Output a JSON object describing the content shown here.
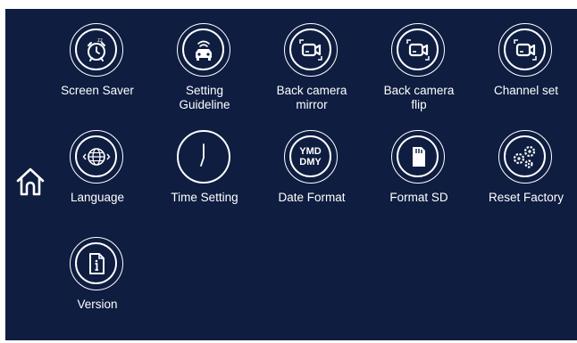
{
  "colors": {
    "background": "#0e1d40",
    "foreground": "#ffffff"
  },
  "home": {
    "icon": "home-icon"
  },
  "menu": [
    {
      "label": "Screen Saver",
      "icon": "alarm-clock-icon"
    },
    {
      "label": "Setting\nGuideline",
      "icon": "car-sensor-icon"
    },
    {
      "label": "Back camera\nmirror",
      "icon": "camera-icon"
    },
    {
      "label": "Back camera\nflip",
      "icon": "camera-icon"
    },
    {
      "label": "Channel set",
      "icon": "camera-icon"
    },
    {
      "label": "Language",
      "icon": "globe-icon"
    },
    {
      "label": "Time Setting",
      "icon": "clock-icon"
    },
    {
      "label": "Date Format",
      "icon": "date-format-icon",
      "icon_text": [
        "YMD",
        "DMY"
      ]
    },
    {
      "label": "Format SD",
      "icon": "sd-card-icon"
    },
    {
      "label": "Reset Factory",
      "icon": "gears-icon"
    },
    {
      "label": "Version",
      "icon": "info-document-icon"
    }
  ]
}
